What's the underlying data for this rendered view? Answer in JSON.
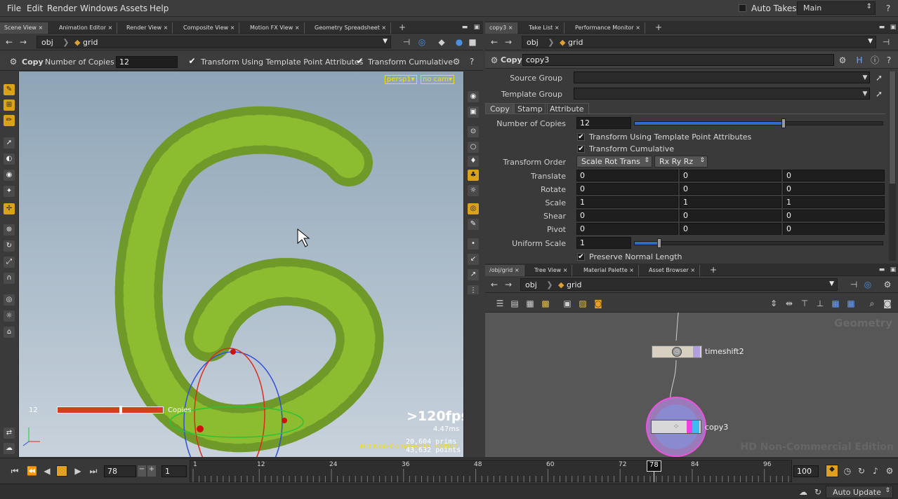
{
  "menubar": {
    "items": [
      "File",
      "Edit",
      "Render",
      "Windows",
      "Assets",
      "Help"
    ],
    "auto_takes": "Auto Takes",
    "desktop": "Main"
  },
  "left_tabs": [
    "Scene View",
    "Animation Editor",
    "Render View",
    "Composite View",
    "Motion FX View",
    "Geometry Spreadsheet"
  ],
  "left_path": {
    "obj": "obj",
    "node": "grid"
  },
  "viewer_toolbar": {
    "node_type": "Copy",
    "copies_label": "Number of Copies",
    "copies_value": "12",
    "tutp_label": "Transform Using Template Point Attributes",
    "cumulative_label": "Transform Cumulative"
  },
  "viewport": {
    "camera_menu": "persp1▾",
    "cam_menu": "no cam▾",
    "handle_value": "12",
    "handle_label": "Copies",
    "fps": ">120fps",
    "ms": "4.47ms",
    "prims": "20,604  prims",
    "points": "43,632 points",
    "watermark": "HD Non-Commercial Edition"
  },
  "right_tabs": [
    "copy3",
    "Take List",
    "Performance Monitor"
  ],
  "right_path": {
    "obj": "obj",
    "node": "grid"
  },
  "params": {
    "type": "Copy",
    "name": "copy3",
    "source_group": "Source Group",
    "template_group": "Template Group",
    "subtabs": [
      "Copy",
      "Stamp",
      "Attribute"
    ],
    "num_copies_label": "Number of Copies",
    "num_copies_value": "12",
    "num_copies_fraction": 0.6,
    "tutp": "Transform Using Template Point Attributes",
    "cumulative": "Transform Cumulative",
    "transform_order_label": "Transform Order",
    "transform_order": "Scale Rot Trans",
    "rot_order": "Rx Ry Rz",
    "rows": [
      {
        "label": "Translate",
        "v": [
          "0",
          "0",
          "0"
        ]
      },
      {
        "label": "Rotate",
        "v": [
          "0",
          "0",
          "0"
        ]
      },
      {
        "label": "Scale",
        "v": [
          "1",
          "1",
          "1"
        ]
      },
      {
        "label": "Shear",
        "v": [
          "0",
          "0",
          "0"
        ]
      },
      {
        "label": "Pivot",
        "v": [
          "0",
          "0",
          "0"
        ]
      }
    ],
    "uniform_scale_label": "Uniform Scale",
    "uniform_scale_value": "1",
    "uniform_scale_fraction": 0.1,
    "preserve_normal": "Preserve Normal Length"
  },
  "network_tabs": [
    "/obj/grid",
    "Tree View",
    "Material Palette",
    "Asset Browser"
  ],
  "network_path": {
    "obj": "obj",
    "node": "grid"
  },
  "network": {
    "context": "Geometry",
    "node1": "timeshift2",
    "node2": "copy3",
    "watermark": "HD Non-Commercial Edition"
  },
  "timeline": {
    "frame": "78",
    "step": "1",
    "start": "1",
    "end": "100",
    "ticks": [
      "1",
      "12",
      "24",
      "36",
      "48",
      "60",
      "72",
      "84",
      "96"
    ],
    "current": "78",
    "auto_update": "Auto Update"
  }
}
